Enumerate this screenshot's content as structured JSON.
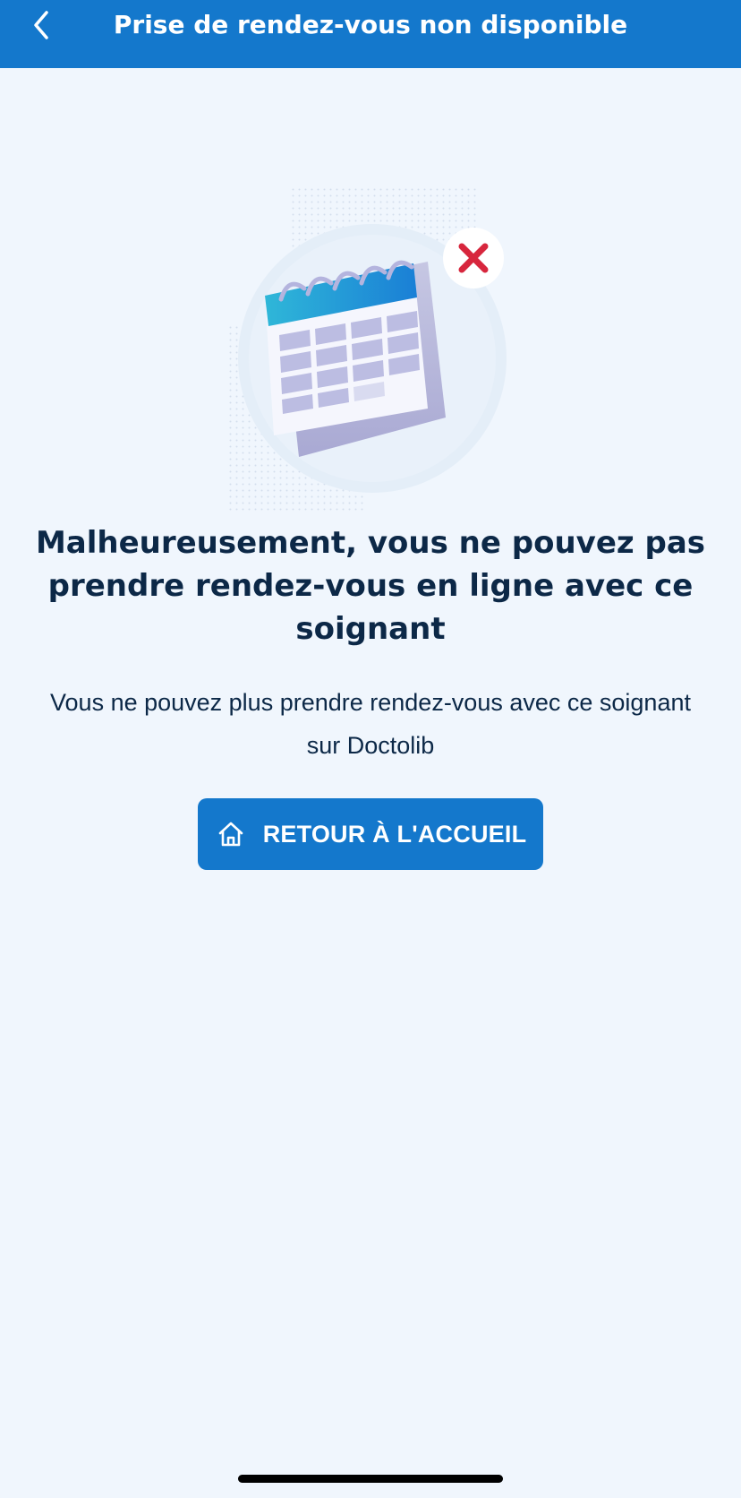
{
  "header": {
    "title": "Prise de rendez-vous non disponible",
    "background_color": "#1478cc",
    "back_icon": "chevron-left-icon"
  },
  "illustration": {
    "icon": "calendar-unavailable-illustration",
    "badge_icon": "close-icon",
    "badge_color": "#d7263d"
  },
  "main": {
    "headline": "Malheureusement, vous ne pouvez pas prendre rendez-vous en ligne avec ce soignant",
    "description": "Vous ne pouvez plus prendre rendez-vous avec ce soignant sur Doctolib",
    "home_button": {
      "label": "RETOUR À L'ACCUEIL",
      "icon": "home-icon",
      "color": "#1478cc"
    }
  },
  "colors": {
    "page_background": "#f0f6fd",
    "text_primary": "#0c2847"
  }
}
